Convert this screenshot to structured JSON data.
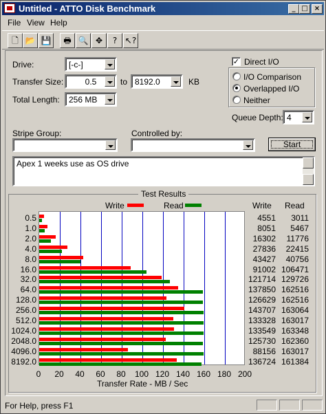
{
  "window": {
    "title": "Untitled - ATTO Disk Benchmark"
  },
  "menu": {
    "file": "File",
    "view": "View",
    "help": "Help"
  },
  "toolbar": {
    "buttons": [
      "new-icon",
      "open-icon",
      "save-icon",
      "print-icon",
      "print-preview-icon",
      "move-icon",
      "help-icon",
      "context-help-icon"
    ]
  },
  "form": {
    "drive_label": "Drive:",
    "drive_value": "[-c-]",
    "transfer_size_label": "Transfer Size:",
    "transfer_from": "0.5",
    "to_label": "to",
    "transfer_to": "8192.0",
    "kb_label": "KB",
    "total_length_label": "Total Length:",
    "total_length_value": "256 MB",
    "direct_io_label": "Direct I/O",
    "direct_io_checked": true,
    "io_comparison_label": "I/O Comparison",
    "overlapped_io_label": "Overlapped I/O",
    "neither_label": "Neither",
    "selected_io_mode": "Overlapped I/O",
    "queue_depth_label": "Queue Depth:",
    "queue_depth_value": "4",
    "stripe_group_label": "Stripe Group:",
    "stripe_group_value": "",
    "controlled_by_label": "Controlled by:",
    "controlled_by_value": "",
    "start_label": "Start",
    "notes": "Apex 1 weeks use as OS drive"
  },
  "results": {
    "title": "Test Results",
    "legend_write": "Write",
    "legend_read": "Read",
    "col_write": "Write",
    "col_read": "Read"
  },
  "chart_data": {
    "type": "bar",
    "title": "Test Results",
    "xlabel": "Transfer Rate - MB / Sec",
    "ylabel": "",
    "xlim": [
      0,
      200
    ],
    "xticks": [
      0,
      20,
      40,
      60,
      80,
      100,
      120,
      140,
      160,
      180,
      200
    ],
    "categories": [
      "0.5",
      "1.0",
      "2.0",
      "4.0",
      "8.0",
      "16.0",
      "32.0",
      "64.0",
      "128.0",
      "256.0",
      "512.0",
      "1024.0",
      "2048.0",
      "4096.0",
      "8192.0"
    ],
    "series": [
      {
        "name": "Write",
        "color": "#ff0000",
        "values": [
          4551,
          8051,
          16302,
          27836,
          43427,
          91002,
          121714,
          137850,
          126629,
          143707,
          133328,
          133549,
          125730,
          88156,
          136724
        ]
      },
      {
        "name": "Read",
        "color": "#008000",
        "values": [
          3011,
          5467,
          11776,
          22415,
          40756,
          106471,
          129726,
          162516,
          162516,
          163064,
          163017,
          163348,
          162360,
          163017,
          161384
        ]
      }
    ],
    "value_unit": "KB/s",
    "grid": true,
    "legend": "top"
  },
  "statusbar": {
    "text": "For Help, press F1"
  }
}
